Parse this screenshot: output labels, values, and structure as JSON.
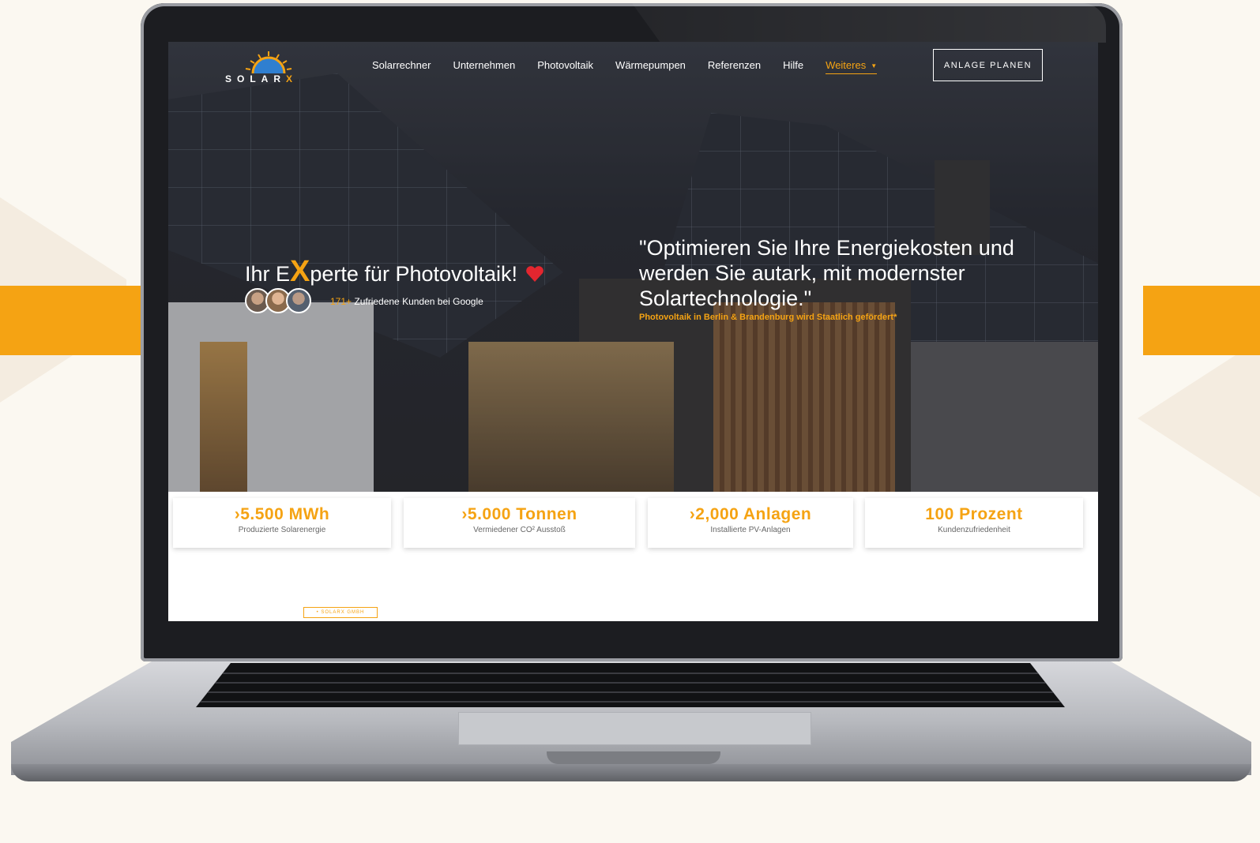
{
  "brand": {
    "logo_text": "SOLAR",
    "logo_x": "X",
    "accent": "#f5a313"
  },
  "nav": {
    "items": [
      "Solarrechner",
      "Unternehmen",
      "Photovoltaik",
      "Wärmepumpen",
      "Referenzen",
      "Hilfe"
    ],
    "more_label": "Weiteres",
    "cta_label": "ANLAGE PLANEN"
  },
  "hero": {
    "headline_pre": "Ihr E",
    "headline_x": "X",
    "headline_post": "perte für Photovoltaik!",
    "heart_icon": "heart-icon",
    "reviews_count": "171+",
    "reviews_text": " Zufriedene Kunden bei Google",
    "quote": "\"Optimieren Sie Ihre Energiekosten und werden Sie autark, mit modernster Solartechnologie.\"",
    "subsidy": "Photovoltaik in Berlin & Brandenburg wird Staatlich gefördert*"
  },
  "stats": [
    {
      "value": "›5.500 MWh",
      "label": "Produzierte Solarenergie"
    },
    {
      "value": "›5.000 Tonnen",
      "label": "Vermiedener CO² Ausstoß"
    },
    {
      "value": "›2,000 Anlagen",
      "label": "Installierte PV-Anlagen"
    },
    {
      "value": "100 Prozent",
      "label": "Kundenzufriedenheit"
    }
  ],
  "badge": "• SOLARX GMBH"
}
